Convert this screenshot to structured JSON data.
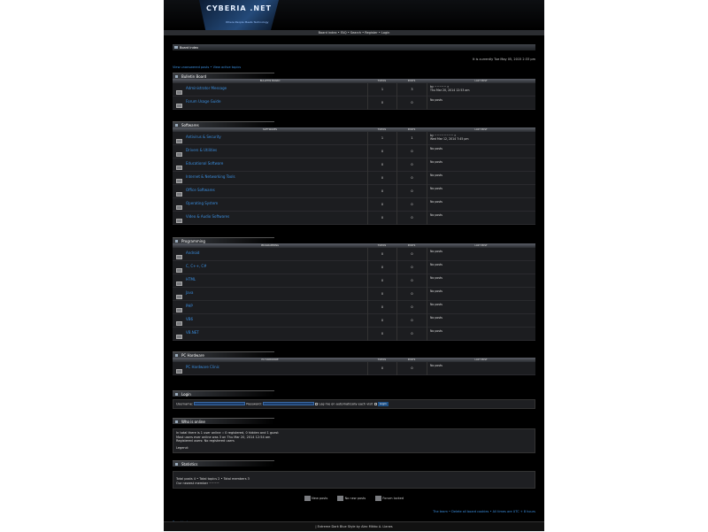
{
  "header": {
    "logo_title": "CYBERIA .NET",
    "logo_sub": "Where People Meets Technology"
  },
  "nav": {
    "text": "Board index • FAQ • Search • Register • Login"
  },
  "crumb": {
    "label": "Board index"
  },
  "time": "It is currently Tue May 05, 2015 2:33 pm",
  "quicklinks": "View unanswered posts • View active topics",
  "columns": {
    "topics": "TOPICS",
    "posts": "POSTS",
    "last": "LAST POST"
  },
  "sections": [
    {
      "title": "Bulletin Board",
      "header": "BULLETIN BOARD",
      "forums": [
        {
          "name": "Administrator Message",
          "topics": "1",
          "posts": "3",
          "last1": "by ~~~~~ »",
          "last2": "Thu Mar 20, 2014 12:53 am"
        },
        {
          "name": "Forum Usage Guide",
          "topics": "0",
          "posts": "0",
          "last1": "No posts",
          "last2": ""
        }
      ]
    },
    {
      "title": "Softwares",
      "header": "SOFTWARES",
      "forums": [
        {
          "name": "Antivirus & Security",
          "topics": "1",
          "posts": "1",
          "last1": "by ~~~~~~~~ »",
          "last2": "Wed Mar 12, 2014 7:45 pm"
        },
        {
          "name": "Drivers & Utilities",
          "topics": "0",
          "posts": "0",
          "last1": "No posts",
          "last2": ""
        },
        {
          "name": "Educational Software",
          "topics": "0",
          "posts": "0",
          "last1": "No posts",
          "last2": ""
        },
        {
          "name": "Internet & Networking Tools",
          "topics": "0",
          "posts": "0",
          "last1": "No posts",
          "last2": ""
        },
        {
          "name": "Office Softwares",
          "topics": "0",
          "posts": "0",
          "last1": "No posts",
          "last2": ""
        },
        {
          "name": "Operating System",
          "topics": "0",
          "posts": "0",
          "last1": "No posts",
          "last2": ""
        },
        {
          "name": "Video & Audio Softwares",
          "topics": "0",
          "posts": "0",
          "last1": "No posts",
          "last2": ""
        }
      ]
    },
    {
      "title": "Programming",
      "header": "PROGRAMMING",
      "forums": [
        {
          "name": "Android",
          "topics": "0",
          "posts": "0",
          "last1": "No posts",
          "last2": ""
        },
        {
          "name": "C, C++, C#",
          "topics": "0",
          "posts": "0",
          "last1": "No posts",
          "last2": ""
        },
        {
          "name": "HTML",
          "topics": "0",
          "posts": "0",
          "last1": "No posts",
          "last2": ""
        },
        {
          "name": "Java",
          "topics": "0",
          "posts": "0",
          "last1": "No posts",
          "last2": ""
        },
        {
          "name": "PHP",
          "topics": "0",
          "posts": "0",
          "last1": "No posts",
          "last2": ""
        },
        {
          "name": "VB6",
          "topics": "0",
          "posts": "0",
          "last1": "No posts",
          "last2": ""
        },
        {
          "name": "VB.NET",
          "topics": "0",
          "posts": "0",
          "last1": "No posts",
          "last2": ""
        }
      ]
    },
    {
      "title": "PC Hardware",
      "header": "PC HARDWARE",
      "forums": [
        {
          "name": "PC Hardware Clinic",
          "topics": "0",
          "posts": "0",
          "last1": "No posts",
          "last2": ""
        }
      ]
    }
  ],
  "login": {
    "title": "Login",
    "username": "Username:",
    "password": "Password:",
    "remember": "Log me on automatically each visit",
    "button": "Login"
  },
  "online": {
    "title": "Who is online",
    "line1": "In total there is 1 user online :: 0 registered, 0 hidden and 1 guest",
    "line2": "Most users ever online was 3 on Thu Mar 20, 2014 12:54 am",
    "line3": "Registered users: No registered users",
    "legend": "Legend:"
  },
  "stats": {
    "title": "Statistics",
    "line1": "Total posts 4 • Total topics 2 • Total members 3",
    "line2": "Our newest member ~~~~"
  },
  "legend": {
    "new": "New posts",
    "nonew": "No new posts",
    "locked": "Forum locked"
  },
  "bottom": {
    "index": "Board index",
    "right": "The team • Delete all board cookies • All times are UTC + 8 hours"
  },
  "footer": "| Extreme Dark Blue Style by Alec Mikko A. Llanes"
}
